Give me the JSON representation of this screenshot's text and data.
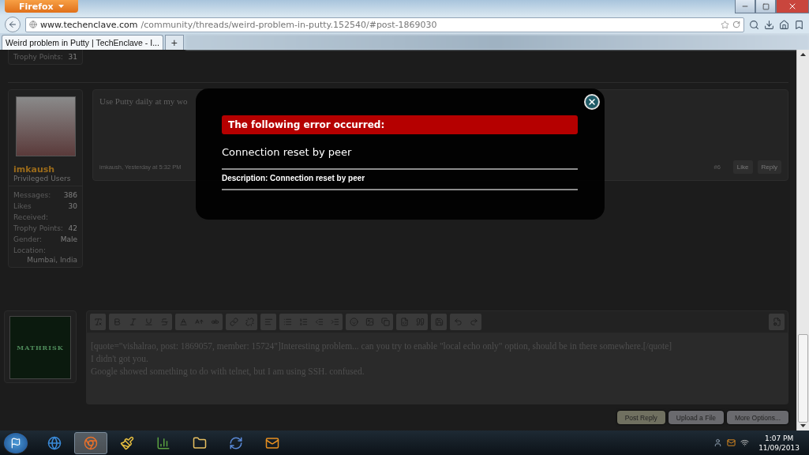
{
  "browser": {
    "app_button": "Firefox",
    "url_host": "www.techenclave.com",
    "url_path": "/community/threads/weird-problem-in-putty.152540/#post-1869030",
    "tabs": [
      {
        "label": "Weird problem in Putty | TechEnclave - I...",
        "selected": true
      }
    ],
    "new_tab": "+"
  },
  "previous_post": {
    "stats": [
      {
        "label": "Trophy Points:",
        "value": "31"
      }
    ]
  },
  "post": {
    "user": {
      "name": "imkaush",
      "title": "Privileged Users",
      "stats": [
        {
          "label": "Messages:",
          "value": "386"
        },
        {
          "label": "Likes Received:",
          "value": "30"
        },
        {
          "label": "Trophy Points:",
          "value": "42"
        },
        {
          "label": "Gender:",
          "value": "Male"
        },
        {
          "label": "Location:"
        }
      ],
      "location": "Mumbai, India"
    },
    "message": "Use Putty daily at my wo",
    "meta": "imkaush, Yesterday at 5:32 PM",
    "number": "#6",
    "actions": [
      "Like",
      "Reply"
    ]
  },
  "modal": {
    "heading": "The following error occurred:",
    "message": "Connection reset by peer",
    "description": "Description: Connection reset by peer"
  },
  "editor": {
    "avatar_text": "MATHRISK",
    "lines": [
      "[quote=\"vishalrao, post: 1869057, member: 15724\"]Interesting problem...  can you try to enable \"local echo only\" option, should be in there somewhere.[/quote]",
      "I didn't got you.",
      "Google showed something to do with telnet, but I am using SSH. confused."
    ],
    "buttons": [
      {
        "label": "Post Reply",
        "kind": "primary"
      },
      {
        "label": "Upload a File",
        "kind": "secondary"
      },
      {
        "label": "More Options...",
        "kind": "secondary"
      }
    ]
  },
  "taskbar": {
    "apps": [
      {
        "kind": "ie",
        "selected": false
      },
      {
        "kind": "firefox",
        "selected": true
      },
      {
        "kind": "paint",
        "selected": false
      },
      {
        "kind": "chart",
        "selected": false
      },
      {
        "kind": "folder",
        "selected": false
      },
      {
        "kind": "sync",
        "selected": false
      },
      {
        "kind": "outlook",
        "selected": false
      }
    ],
    "time": "1:07 PM",
    "date": "11/09/2013"
  }
}
